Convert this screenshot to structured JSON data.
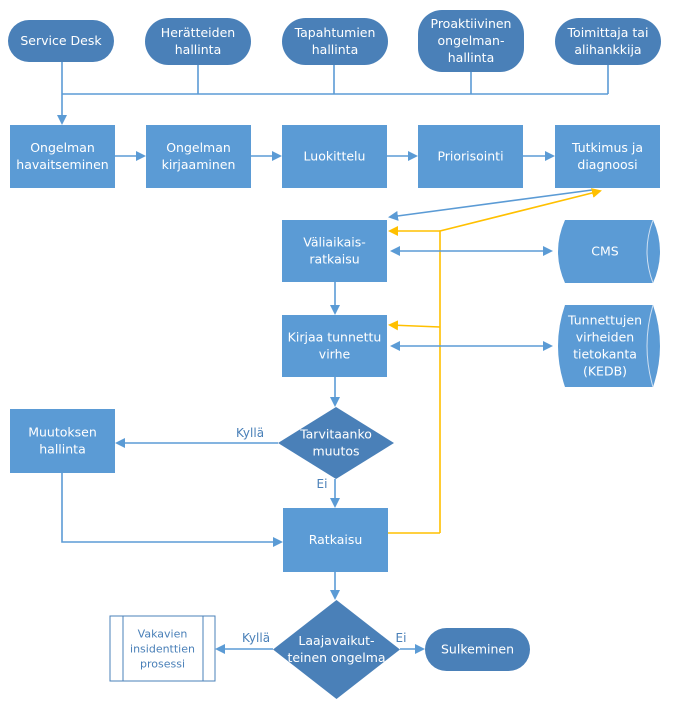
{
  "sources": [
    {
      "id": "service-desk",
      "lines": [
        "Service Desk"
      ]
    },
    {
      "id": "heratteiden-hallinta",
      "lines": [
        "Herätteiden",
        "hallinta"
      ]
    },
    {
      "id": "tapahtumien-hallinta",
      "lines": [
        "Tapahtumien",
        "hallinta"
      ]
    },
    {
      "id": "proaktiivinen",
      "lines": [
        "Proaktiivinen",
        "ongelman-",
        "hallinta"
      ]
    },
    {
      "id": "toimittaja",
      "lines": [
        "Toimittaja tai",
        "alihankkija"
      ]
    }
  ],
  "steps": [
    {
      "id": "havaitseminen",
      "lines": [
        "Ongelman",
        "havaitseminen"
      ]
    },
    {
      "id": "kirjaaminen",
      "lines": [
        "Ongelman",
        "kirjaaminen"
      ]
    },
    {
      "id": "luokittelu",
      "lines": [
        "Luokittelu"
      ]
    },
    {
      "id": "priorisointi",
      "lines": [
        "Priorisointi"
      ]
    },
    {
      "id": "tutkimus",
      "lines": [
        "Tutkimus ja",
        "diagnoosi"
      ]
    }
  ],
  "valiaikais": {
    "lines": [
      "Väliaikais-",
      "ratkaisu"
    ]
  },
  "kirjaa": {
    "lines": [
      "Kirjaa tunnettu",
      "virhe"
    ]
  },
  "cms": {
    "lines": [
      "CMS"
    ]
  },
  "kedb": {
    "lines": [
      "Tunnettujen",
      "virheiden",
      "tietokanta",
      "(KEDB)"
    ]
  },
  "decision1": {
    "lines": [
      "Tarvitaanko",
      "muutos"
    ],
    "yes": "Kyllä",
    "no": "Ei"
  },
  "muutoksen": {
    "lines": [
      "Muutoksen",
      "hallinta"
    ]
  },
  "ratkaisu": {
    "lines": [
      "Ratkaisu"
    ]
  },
  "decision2": {
    "lines": [
      "Laajavaikut-",
      "teinen ongelma"
    ],
    "yes": "Kyllä",
    "no": "Ei"
  },
  "vakavien": {
    "lines": [
      "Vakavien",
      "insidenttien",
      "prosessi"
    ]
  },
  "sulkeminen": {
    "lines": [
      "Sulkeminen"
    ]
  },
  "colors": {
    "box": "#5b9bd5",
    "terminator": "#4a80b8",
    "line": "#5b9bd5",
    "feedback": "#ffc000"
  }
}
